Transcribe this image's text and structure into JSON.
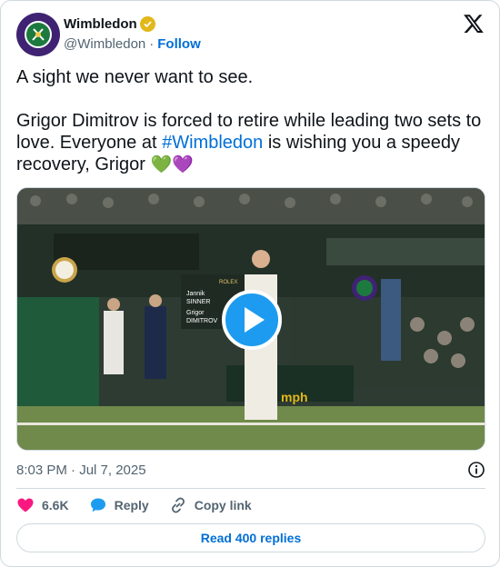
{
  "author": {
    "display_name": "Wimbledon",
    "handle": "@Wimbledon",
    "follow_label": "Follow",
    "separator": "·",
    "verified_color": "#e2b719",
    "avatar_color": "#3f2372"
  },
  "tweet": {
    "line1": "A sight we never want to see.",
    "line2_before": "Grigor Dimitrov is forced to retire while leading two sets to love. Everyone at ",
    "hashtag": "#Wimbledon",
    "line2_after": " is wishing you a speedy recovery, Grigor ",
    "heart_green": "💚",
    "heart_purple": "💜"
  },
  "media": {
    "type": "video",
    "scoreboard_name1": "Jannik",
    "scoreboard_name2": "SINNER",
    "scoreboard_name3": "Grigor",
    "scoreboard_name4": "DIMITROV",
    "scoreboard_brand": "ROLEX",
    "board_text": "mph"
  },
  "meta": {
    "timestamp": "8:03 PM · Jul 7, 2025"
  },
  "actions": {
    "like_count": "6.6K",
    "reply_label": "Reply",
    "copy_link_label": "Copy link"
  },
  "read_replies_label": "Read 400 replies",
  "colors": {
    "link": "#006fd6",
    "like": "#f91880",
    "reply": "#1d9bf0",
    "muted": "#536471",
    "border": "#cfd9de"
  },
  "icons": [
    "verified-badge-icon",
    "x-logo-icon",
    "play-icon",
    "info-icon",
    "heart-icon",
    "reply-bubble-icon",
    "link-icon"
  ]
}
